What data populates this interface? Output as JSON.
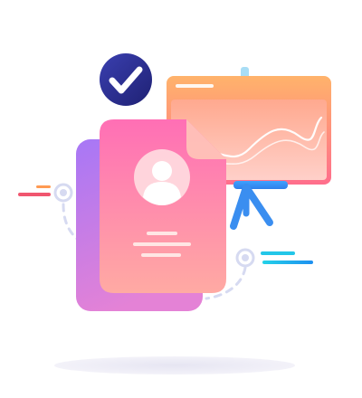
{
  "illustration": {
    "subject": "profile-card-with-presentation-board",
    "icons": [
      "check-badge-icon",
      "user-avatar-icon",
      "presentation-board-icon",
      "line-chart-icon",
      "target-node-icon"
    ],
    "colors": {
      "check_badge": "#2C2F8E",
      "card_back_top": "#A777F6",
      "card_back_bottom": "#E07AD9",
      "card_front_top": "#FF6FB5",
      "card_front_bottom": "#FFA7A3",
      "board_frame_top": "#FFB36B",
      "board_frame_bottom": "#FF6E8C",
      "board_screen": "#FFC1AE",
      "stand_blue": "#2F8EF2",
      "dash_line": "#D7DBF3",
      "accent_cyan": "#23C6E8",
      "accent_blue": "#1E8FF0",
      "accent_red": "#F0566F",
      "accent_orange": "#FF9A52",
      "shadow": "#ECEBF6"
    }
  }
}
